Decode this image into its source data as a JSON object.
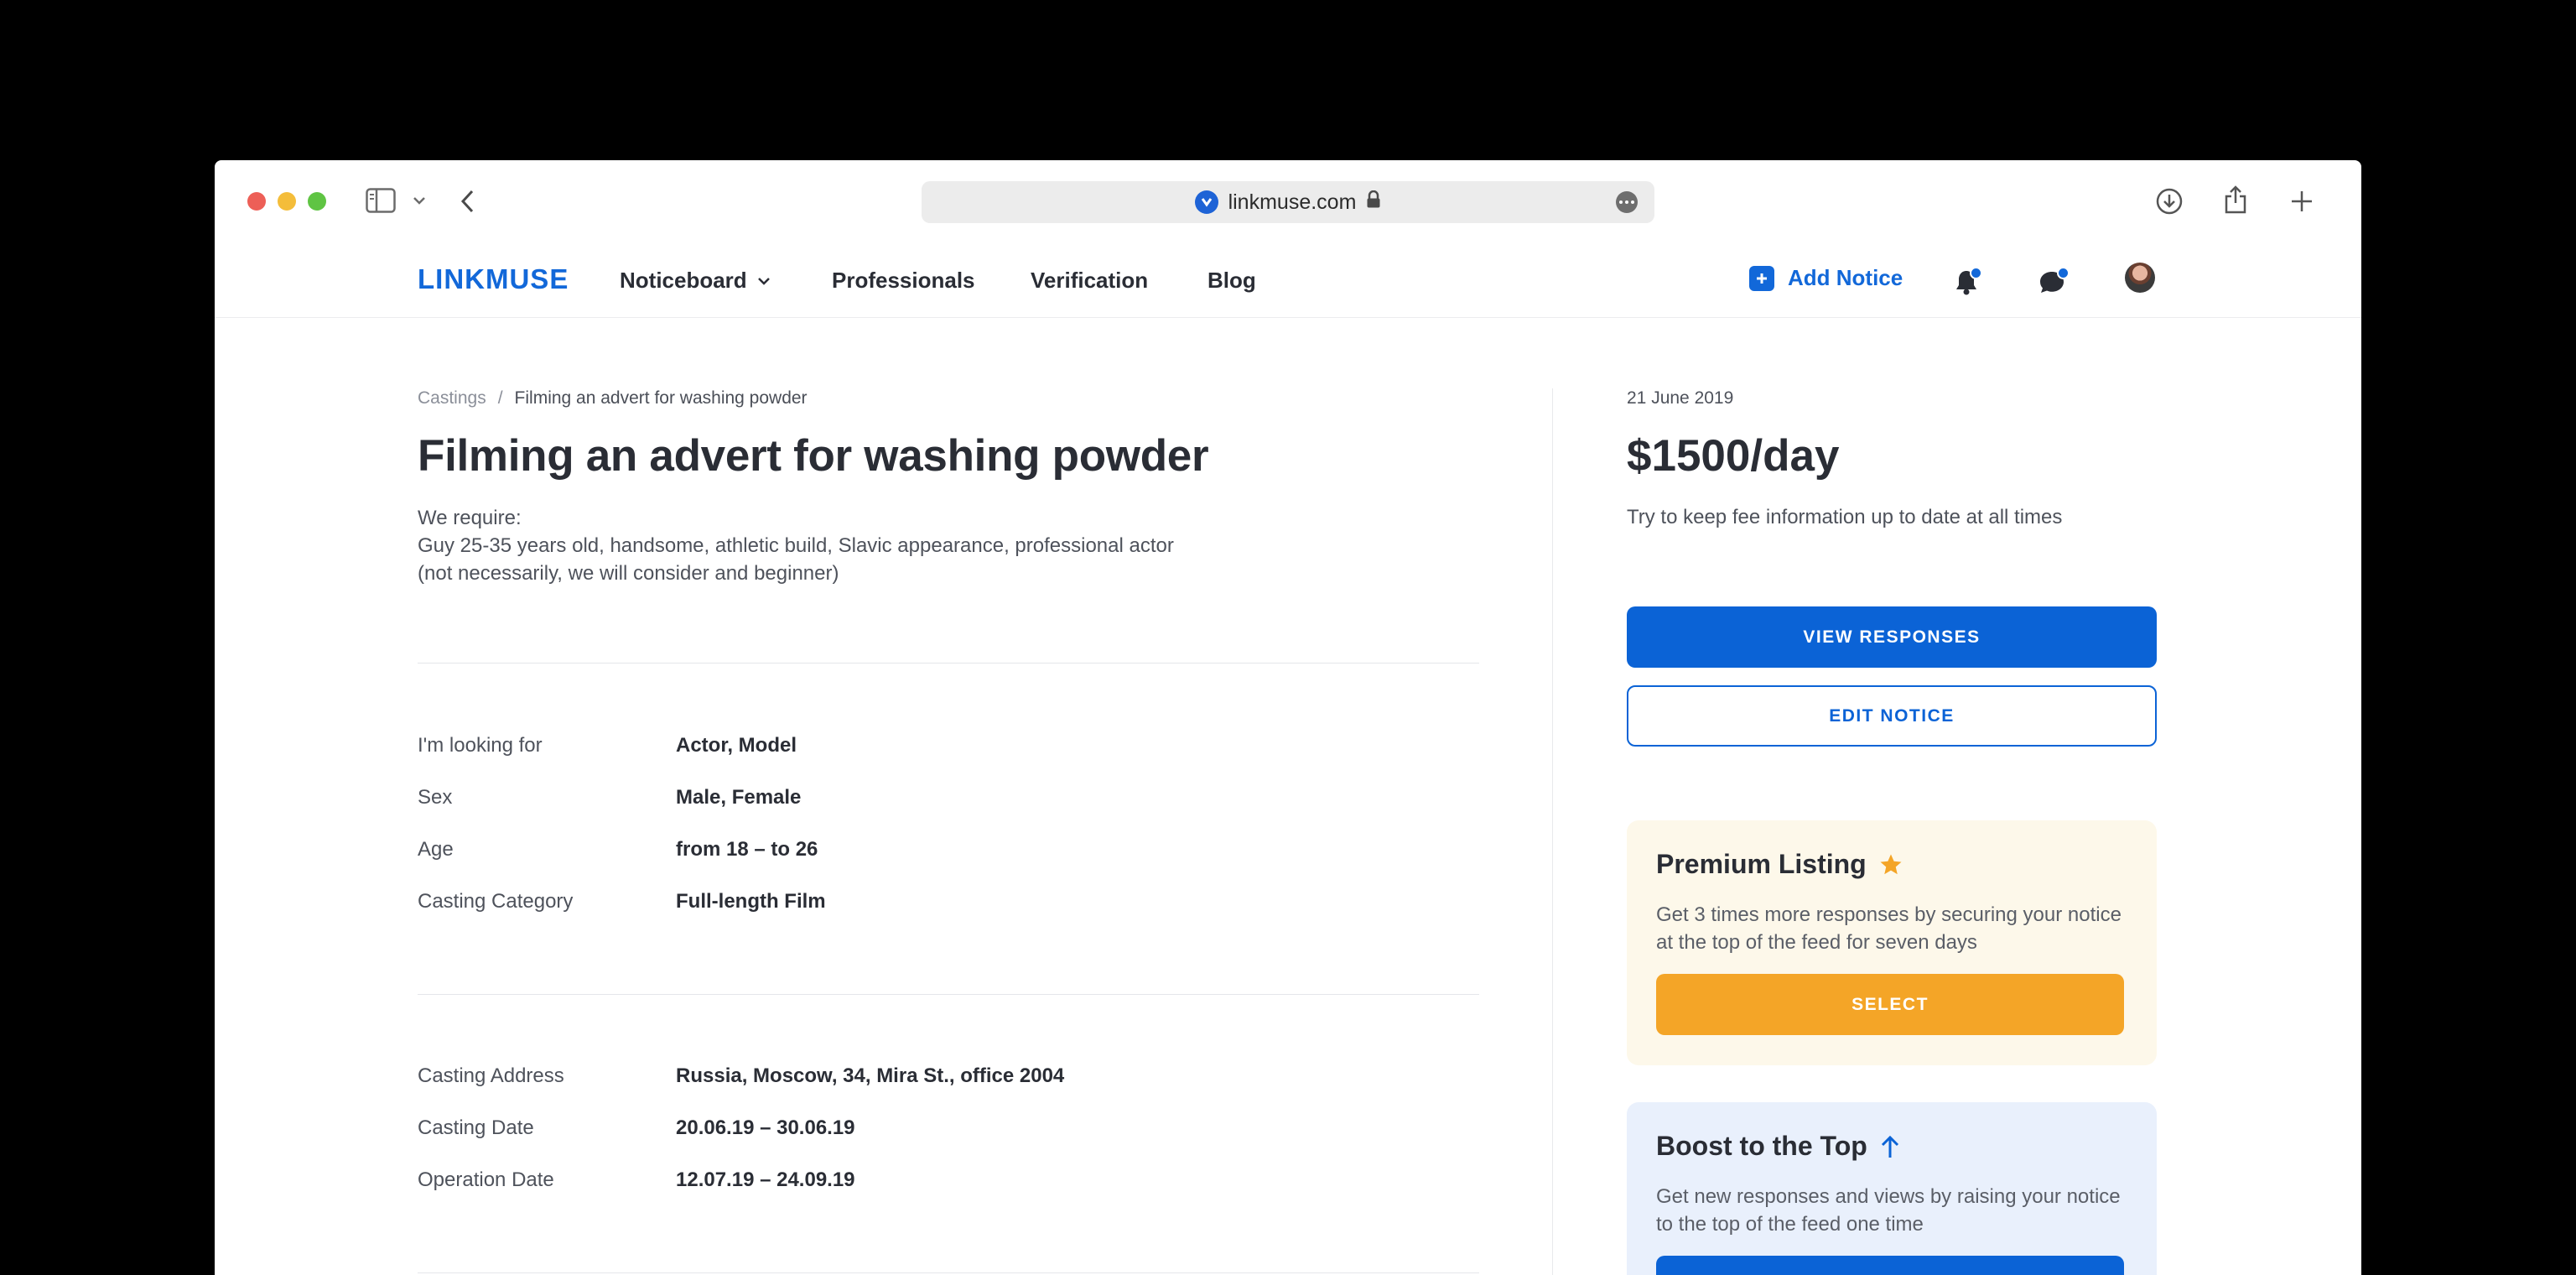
{
  "browser": {
    "url": "linkmuse.com"
  },
  "nav": {
    "logo": "LINKMUSE",
    "items": [
      {
        "label": "Noticeboard"
      },
      {
        "label": "Professionals"
      },
      {
        "label": "Verification"
      },
      {
        "label": "Blog"
      }
    ],
    "add_notice": "Add Notice",
    "accent": "#1268d9"
  },
  "breadcrumb": {
    "parent": "Castings",
    "separator": "/",
    "current": "Filming an advert for washing powder"
  },
  "notice": {
    "title": "Filming an advert for washing powder",
    "requirements": [
      "We require:",
      "Guy 25-35 years old, handsome, athletic build, Slavic appearance, professional actor",
      "(not necessarily, we will consider and beginner)"
    ],
    "details": [
      {
        "label": "I'm looking for",
        "value": "Actor, Model"
      },
      {
        "label": "Sex",
        "value": "Male, Female"
      },
      {
        "label": "Age",
        "value": "from 18 – to 26"
      },
      {
        "label": "Casting Category",
        "value": "Full-length Film"
      }
    ],
    "location": [
      {
        "label": "Casting Address",
        "value": "Russia, Moscow, 34, Mira St., office 2004"
      },
      {
        "label": "Casting Date",
        "value": "20.06.19 – 30.06.19"
      },
      {
        "label": "Operation Date",
        "value": "12.07.19 – 24.09.19"
      }
    ]
  },
  "sidebar": {
    "date": "21 June 2019",
    "price": "$1500/day",
    "fee_hint": "Try to keep fee information up to date at all times",
    "view_responses": "VIEW RESPONSES",
    "edit_notice": "EDIT NOTICE",
    "premium": {
      "title": "Premium Listing",
      "text": "Get 3 times more responses by securing your notice at the top of the feed for seven days",
      "button": "SELECT",
      "color": "#f4a527"
    },
    "boost": {
      "title": "Boost to the Top",
      "text": "Get new responses and views by raising your notice to the top of the feed one time",
      "color": "#0b63d6"
    }
  }
}
